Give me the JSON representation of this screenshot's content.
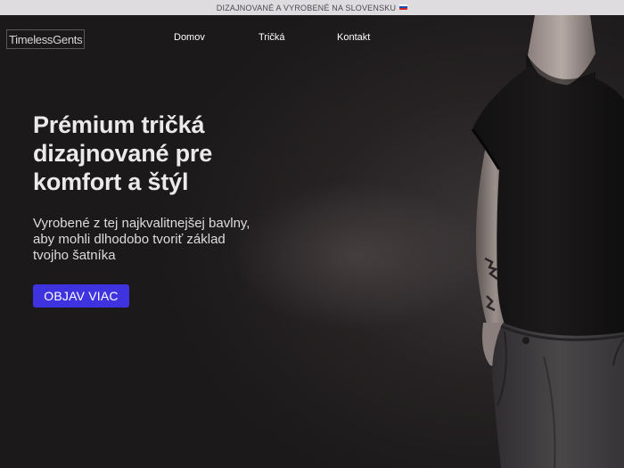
{
  "announcement": {
    "text": "DIZAJNOVANÉ A VYROBENÉ NA SLOVENSKU",
    "flag_icon": "slovak-flag-icon"
  },
  "header": {
    "logo": "TimelessGents",
    "nav": {
      "home": "Domov",
      "tees": "Tričká",
      "contact": "Kontakt"
    }
  },
  "hero": {
    "headline": "Prémium tričká dizajnované pre komfort a štýl",
    "subheadline": "Vyrobené z tej najkvalitnejšej bavlny, aby mohli dlhodobo tvoriť základ tvojho šatníka",
    "cta_label": "OBJAV VIAC",
    "image": "model-in-black-tshirt"
  },
  "colors": {
    "accent": "#3f33e0",
    "background": "#1c1a1b",
    "topbar": "#dedcdf"
  }
}
